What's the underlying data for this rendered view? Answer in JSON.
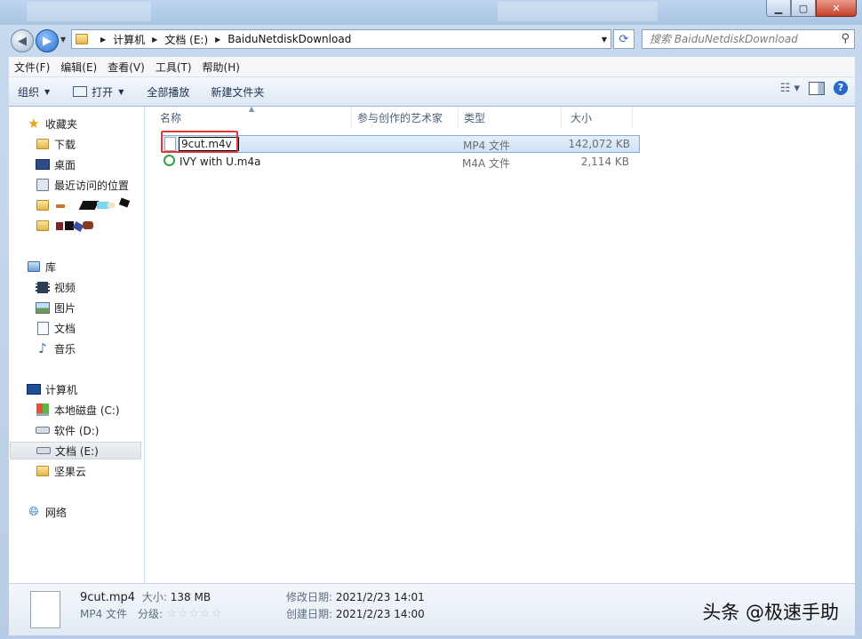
{
  "address": {
    "crumbs": [
      "计算机",
      "文档 (E:)",
      "BaiduNetdiskDownload"
    ],
    "search_placeholder": "搜索 BaiduNetdiskDownload"
  },
  "menu": [
    "文件(F)",
    "编辑(E)",
    "查看(V)",
    "工具(T)",
    "帮助(H)"
  ],
  "toolbar": {
    "organize": "组织",
    "open": "打开",
    "play_all": "全部播放",
    "new_folder": "新建文件夹"
  },
  "nav": {
    "favorites_title": "收藏夹",
    "favorites": [
      "下载",
      "桌面",
      "最近访问的位置"
    ],
    "libraries_title": "库",
    "libraries": [
      "视频",
      "图片",
      "文档",
      "音乐"
    ],
    "computer_title": "计算机",
    "drives": [
      "本地磁盘 (C:)",
      "软件 (D:)",
      "文档 (E:)",
      "坚果云"
    ],
    "network_title": "网络"
  },
  "columns": [
    "名称",
    "参与创作的艺术家",
    "类型",
    "大小"
  ],
  "files": [
    {
      "name": "9cut.m4v",
      "type": "MP4 文件",
      "size": "142,072 KB",
      "icon": "blank-file-icon",
      "renaming": true
    },
    {
      "name": "IVY with U.m4a",
      "type": "M4A 文件",
      "size": "2,114 KB",
      "icon": "media-player-icon",
      "renaming": false
    }
  ],
  "details": {
    "filename": "9cut.mp4",
    "size_label": "大小:",
    "size": "138 MB",
    "type": "MP4 文件",
    "rating_label": "分级:",
    "rating": 0,
    "modified_label": "修改日期:",
    "modified": "2021/2/23 14:01",
    "created_label": "创建日期:",
    "created": "2021/2/23 14:00"
  },
  "watermark": "头条 @极速手助"
}
